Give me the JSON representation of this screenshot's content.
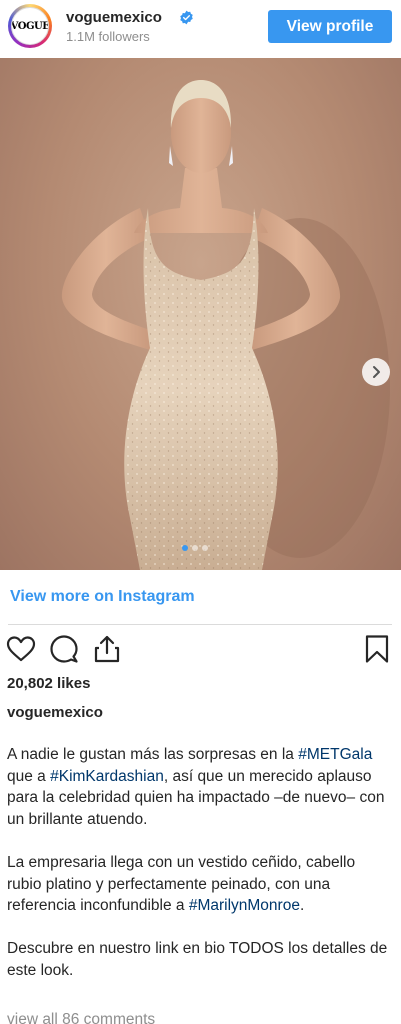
{
  "header": {
    "avatar_text": "VOGUE",
    "account_name": "voguemexico",
    "followers": "1.1M followers",
    "view_profile_label": "View profile"
  },
  "post": {
    "carousel": {
      "current_slide": 1,
      "total_slides": 3
    },
    "view_more_label": "View more on Instagram",
    "likes": "20,802 likes",
    "caption_user": "voguemexico",
    "caption": {
      "p1_a": "A nadie le gustan más las sorpresas en la ",
      "p1_tag1": "#METGala",
      "p1_b": " que a ",
      "p1_tag2": "#KimKardashian",
      "p1_c": ", así que un merecido aplauso para la celebridad quien ha impactado –de nuevo– con un brillante atuendo.",
      "p2_a": "La empresaria llega con un vestido ceñido, cabello rubio platino y perfectamente peinado, con una referencia inconfundible a ",
      "p2_tag": "#MarilynMonroe",
      "p2_b": ".",
      "p3": "Descubre en nuestro link en bio TODOS los detalles de este look."
    },
    "comments_link": "view all 86 comments"
  },
  "colors": {
    "accent": "#3897f0",
    "hashtag": "#00376b",
    "muted": "#8e8e8e"
  },
  "icons": [
    "verified-badge-icon",
    "chevron-right-icon",
    "heart-icon",
    "comment-icon",
    "share-icon",
    "bookmark-icon"
  ]
}
